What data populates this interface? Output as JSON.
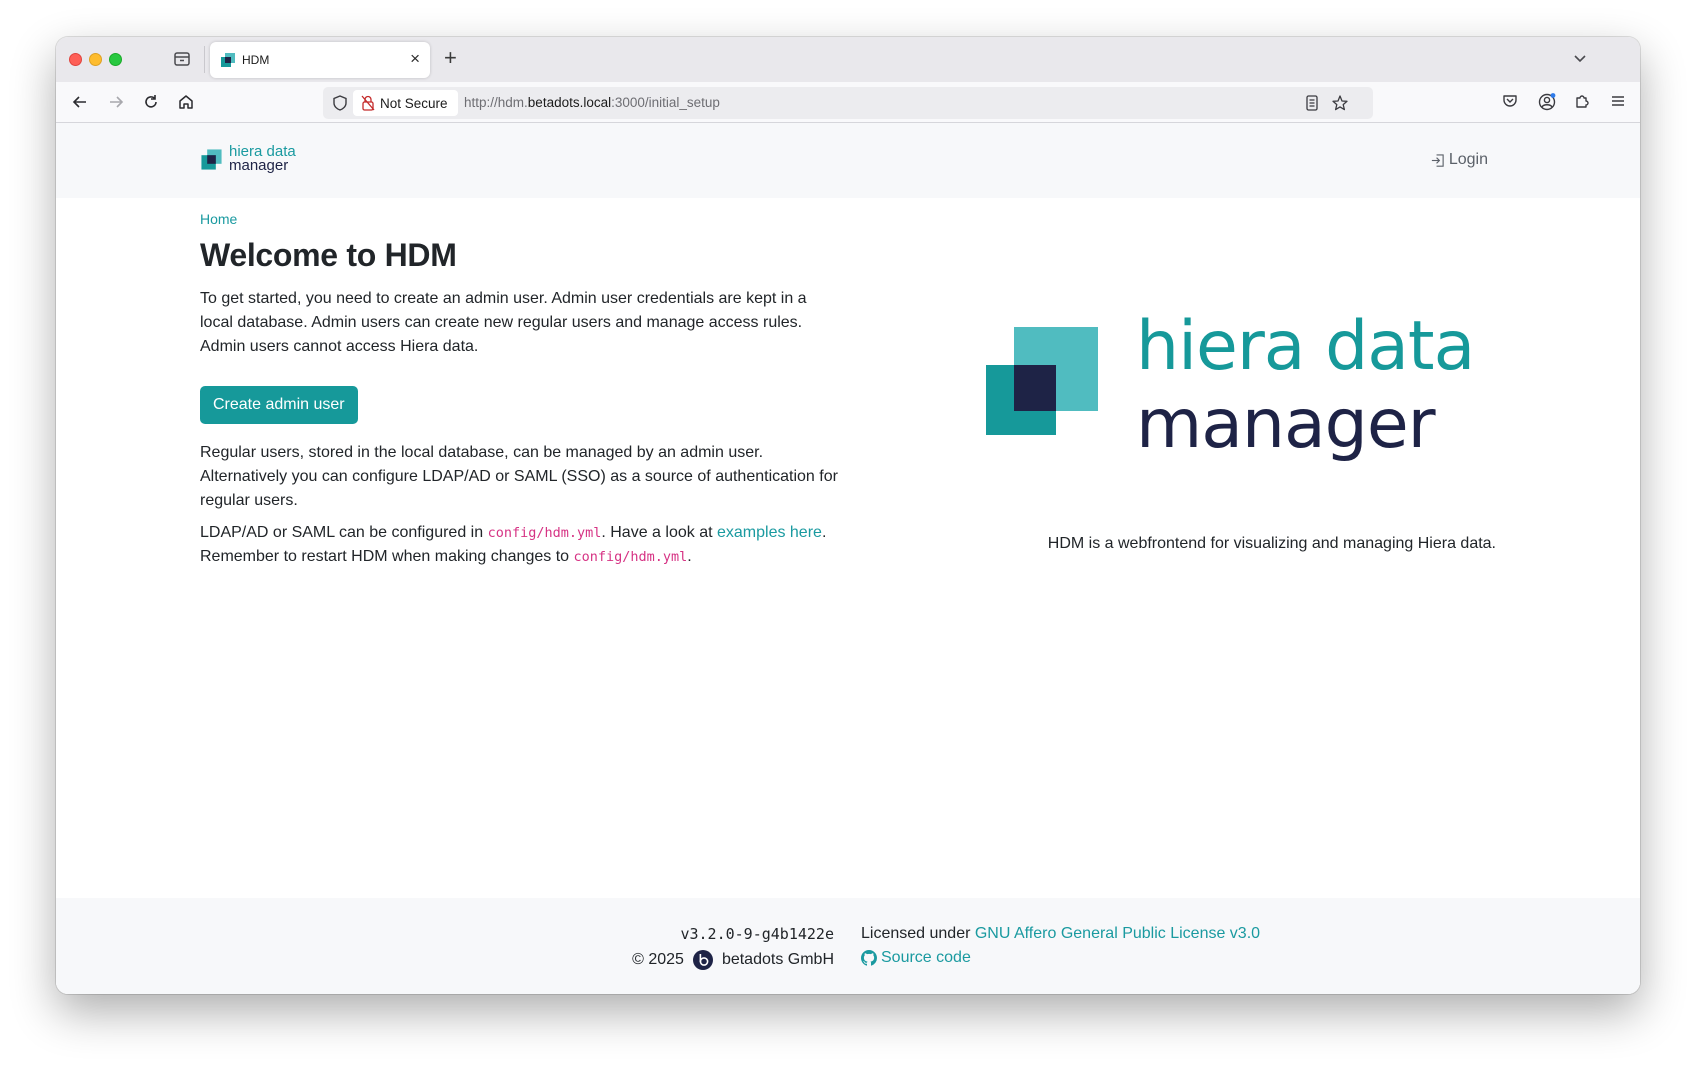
{
  "browser": {
    "tab": {
      "title": "HDM",
      "close": "×"
    },
    "new_tab": "+",
    "security_label": "Not Secure",
    "url": {
      "prefix": "http://hdm.",
      "host": "betadots.local",
      "suffix": ":3000/initial_setup"
    }
  },
  "header": {
    "brand": {
      "line1": "hiera data",
      "line2": "manager"
    },
    "login": "Login"
  },
  "breadcrumb": "Home",
  "main": {
    "title": "Welcome to HDM",
    "intro": "To get started, you need to create an admin user. Admin user credentials are kept in a local database. Admin users can create new regular users and manage access rules. Admin users cannot access Hiera data.",
    "create_button": "Create admin user",
    "para2": "Regular users, stored in the local database, can be managed by an admin user. Alternatively you can configure LDAP/AD or SAML (SSO) as a source of authentication for regular users.",
    "para3": {
      "part1": "LDAP/AD or SAML can be configured in ",
      "code1": "config/hdm.yml",
      "part2": ". Have a look at ",
      "link": "examples here",
      "part3": ". Remember to restart HDM when making changes to ",
      "code2": "config/hdm.yml",
      "part4": "."
    }
  },
  "hero": {
    "logo_line1": "hiera data",
    "logo_line2": "manager",
    "tagline": "HDM is a webfrontend for visualizing and managing Hiera data."
  },
  "footer": {
    "version": "v3.2.0-9-g4b1422e",
    "copyright": "© 2025",
    "company": "betadots GmbH",
    "license_prefix": "Licensed under ",
    "license_link": "GNU Affero General Public License v3.0",
    "source": "Source code"
  },
  "colors": {
    "accent": "#16999a",
    "navy": "#1e2346",
    "light_teal": "#50bcc0",
    "code": "#d63384"
  }
}
